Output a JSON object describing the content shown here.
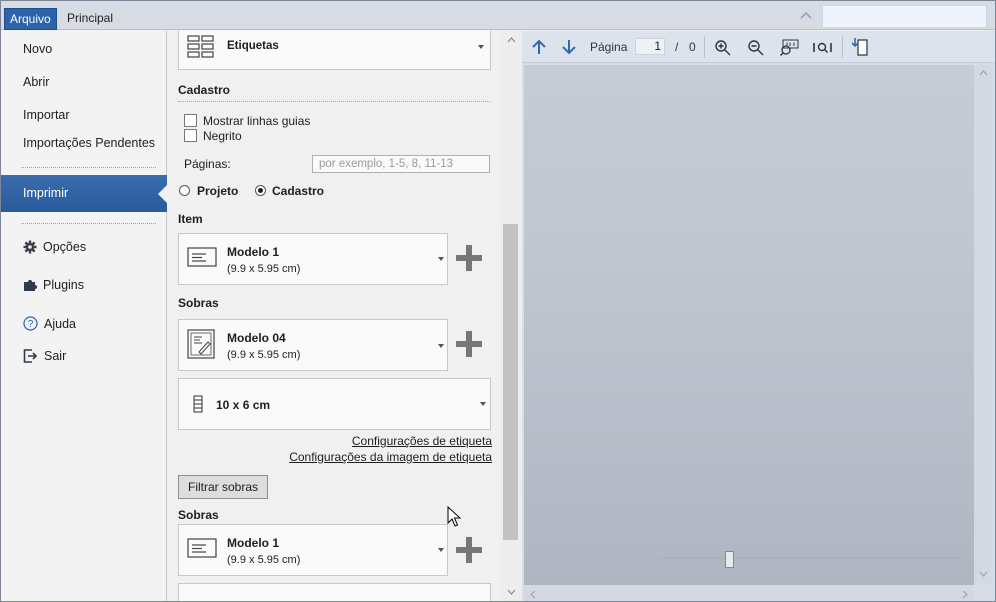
{
  "ribbon": {
    "tabs": [
      {
        "label": "Arquivo",
        "active": true
      },
      {
        "label": "Principal",
        "active": false
      }
    ]
  },
  "sidebar": {
    "items": [
      {
        "label": "Novo"
      },
      {
        "label": "Abrir"
      },
      {
        "label": "Importar"
      },
      {
        "label": "Importações Pendentes"
      },
      {
        "label": "Imprimir",
        "selected": true
      },
      {
        "label": "Opções",
        "icon": "gear-icon"
      },
      {
        "label": "Plugins",
        "icon": "puzzle-icon"
      },
      {
        "label": "Ajuda",
        "icon": "help-icon"
      },
      {
        "label": "Sair",
        "icon": "exit-icon"
      }
    ]
  },
  "print_settings": {
    "layout_select": {
      "label": "Etiquetas",
      "icon": "grid-layout-icon"
    },
    "cadastro": {
      "heading": "Cadastro",
      "show_guides_label": "Mostrar linhas guias",
      "show_guides_checked": false,
      "bold_label": "Negrito",
      "bold_checked": false,
      "pages_label": "Páginas:",
      "pages_placeholder": "por exemplo, 1-5, 8, 11-13",
      "radio_projeto": "Projeto",
      "radio_cadastro": "Cadastro",
      "selected_radio": "Cadastro"
    },
    "item": {
      "heading": "Item",
      "model_title": "Modelo 1",
      "model_size": "(9.9 x 5.95 cm)"
    },
    "sobras": {
      "heading": "Sobras",
      "model_title": "Modelo 04",
      "model_size": "(9.9 x 5.95 cm)",
      "label_size": "10 x 6 cm",
      "link_label_config": "Configurações de etiqueta",
      "link_label_image_config": "Configurações da imagem de etiqueta",
      "filter_button": "Filtrar sobras"
    },
    "sobras2": {
      "heading": "Sobras",
      "model_title": "Modelo 1",
      "model_size": "(9.9 x 5.95 cm)"
    }
  },
  "preview": {
    "page_label": "Página",
    "current_page": "1",
    "separator": "/",
    "total_pages": "0",
    "zoom_slider_value": 0.23
  },
  "colors": {
    "accent": "#2d63a8",
    "preview_bg": "#c2c8d2"
  }
}
